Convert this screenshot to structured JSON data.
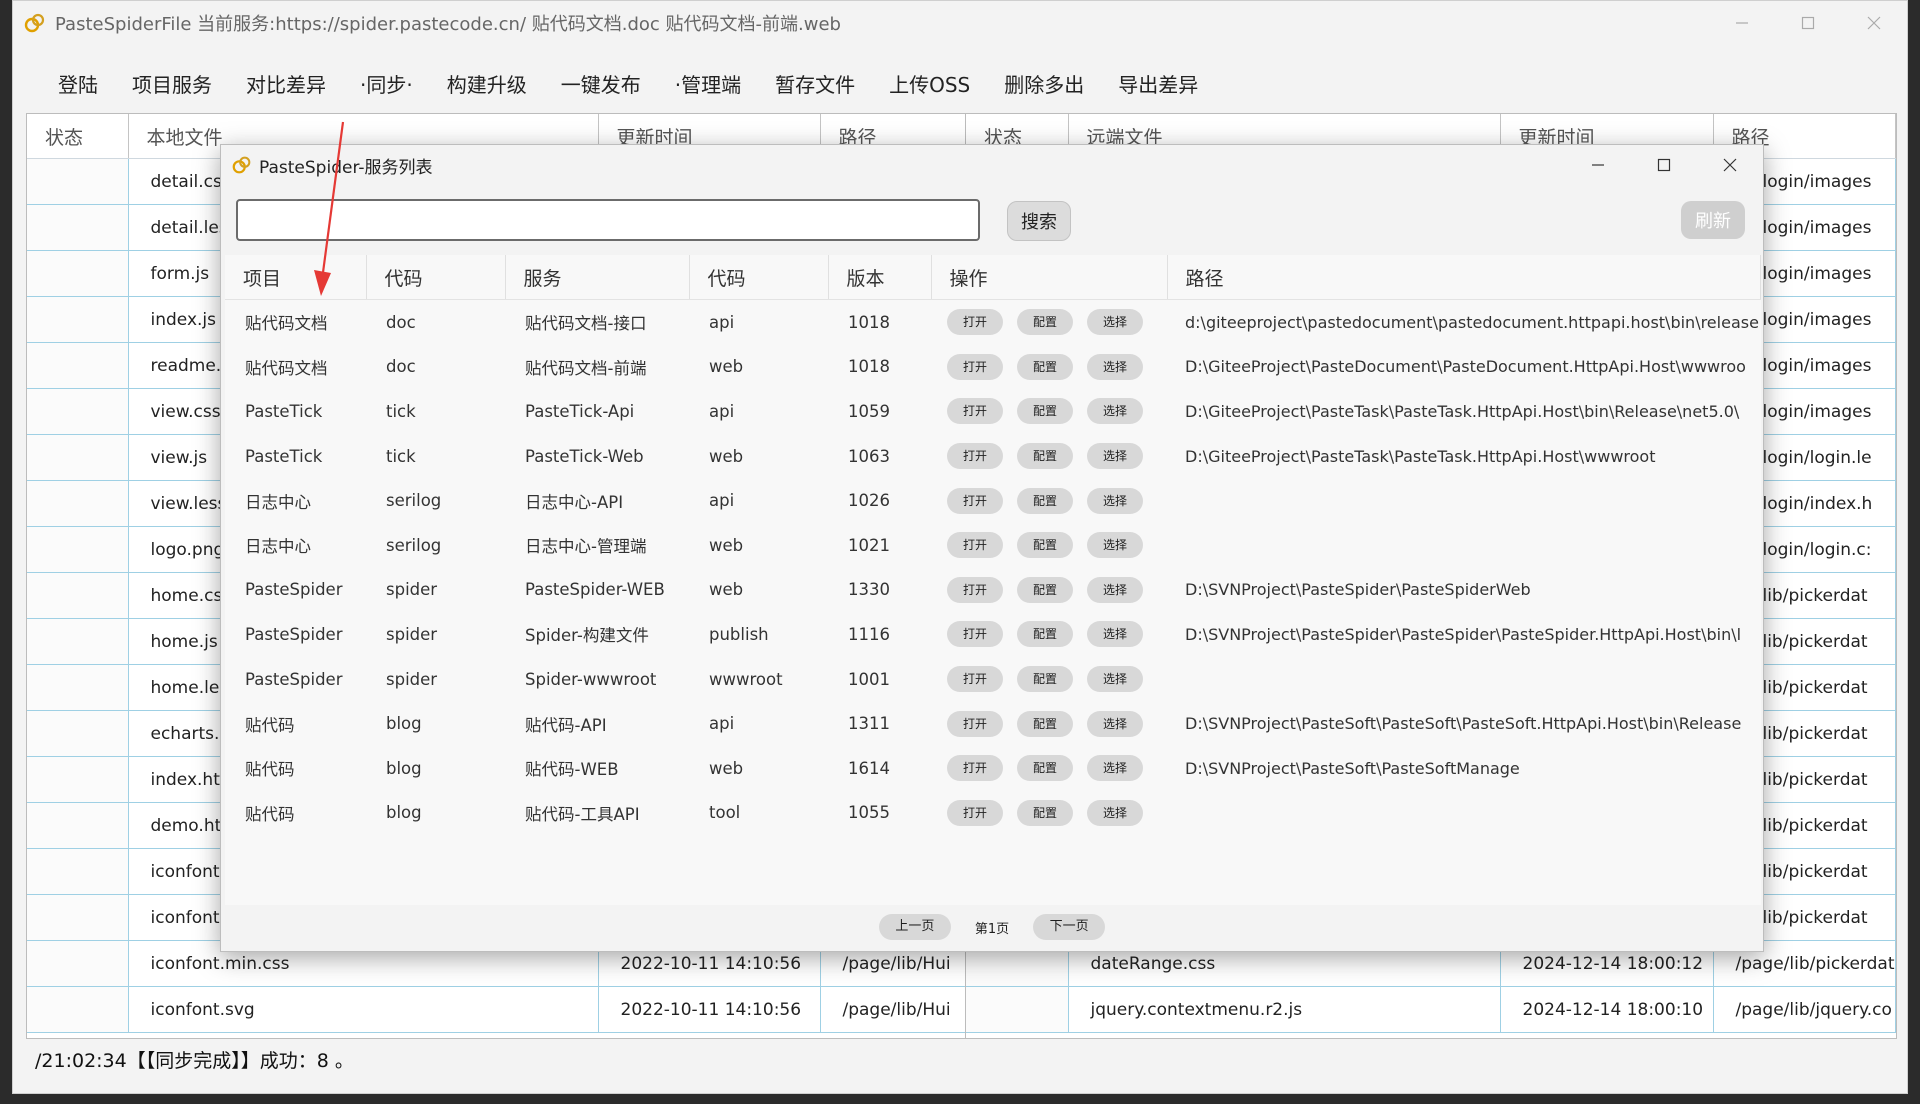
{
  "window": {
    "title": "PasteSpiderFile 当前服务:https://spider.pastecode.cn/ 贴代码文档.doc 贴代码文档-前端.web"
  },
  "menu": [
    "登陆",
    "项目服务",
    "对比差异",
    "·同步·",
    "构建升级",
    "一键发布",
    "·管理端",
    "暂存文件",
    "上传OSS",
    "删除多出",
    "导出差异"
  ],
  "left_table": {
    "headers": [
      "状态",
      "本地文件",
      "更新时间",
      "路径"
    ],
    "rows": [
      [
        "",
        "detail.css",
        "",
        ""
      ],
      [
        "",
        "detail.less",
        "",
        ""
      ],
      [
        "",
        "form.js",
        "",
        ""
      ],
      [
        "",
        "index.js",
        "",
        ""
      ],
      [
        "",
        "readme.md",
        "",
        ""
      ],
      [
        "",
        "view.css",
        "",
        ""
      ],
      [
        "",
        "view.js",
        "",
        ""
      ],
      [
        "",
        "view.less",
        "",
        ""
      ],
      [
        "",
        "logo.png",
        "",
        ""
      ],
      [
        "",
        "home.css",
        "",
        ""
      ],
      [
        "",
        "home.js",
        "",
        ""
      ],
      [
        "",
        "home.less",
        "",
        ""
      ],
      [
        "",
        "echarts.min.js",
        "",
        ""
      ],
      [
        "",
        "index.html",
        "",
        ""
      ],
      [
        "",
        "demo.html",
        "",
        ""
      ],
      [
        "",
        "iconfont.css",
        "",
        ""
      ],
      [
        "",
        "iconfont.eot",
        "",
        ""
      ],
      [
        "",
        "iconfont.min.css",
        "2022-10-11 14:10:56",
        "/page/lib/Hui"
      ],
      [
        "",
        "iconfont.svg",
        "2022-10-11 14:10:56",
        "/page/lib/Hui"
      ]
    ]
  },
  "right_table": {
    "headers": [
      "状态",
      "远端文件",
      "更新时间",
      "路径"
    ],
    "rows": [
      [
        "",
        "",
        "",
        "ge/login/images"
      ],
      [
        "",
        "",
        "",
        "ge/login/images"
      ],
      [
        "",
        "",
        "",
        "ge/login/images"
      ],
      [
        "",
        "",
        "",
        "ge/login/images"
      ],
      [
        "",
        "",
        "",
        "ge/login/images"
      ],
      [
        "",
        "",
        "",
        "ge/login/images"
      ],
      [
        "",
        "",
        "",
        "ge/login/login.le"
      ],
      [
        "",
        "",
        "",
        "ge/login/index.h"
      ],
      [
        "",
        "",
        "",
        "ge/login/login.c:"
      ],
      [
        "",
        "",
        "",
        "ge/lib/pickerdat"
      ],
      [
        "",
        "",
        "",
        "ge/lib/pickerdat"
      ],
      [
        "",
        "",
        "",
        "ge/lib/pickerdat"
      ],
      [
        "",
        "",
        "",
        "ge/lib/pickerdat"
      ],
      [
        "",
        "",
        "",
        "ge/lib/pickerdat"
      ],
      [
        "",
        "",
        "",
        "ge/lib/pickerdat"
      ],
      [
        "",
        "",
        "",
        "ge/lib/pickerdat"
      ],
      [
        "",
        "",
        "",
        "ge/lib/pickerdat"
      ],
      [
        "",
        "dateRange.css",
        "2024-12-14 18:00:12",
        "/page/lib/pickerdat"
      ],
      [
        "",
        "jquery.contextmenu.r2.js",
        "2024-12-14 18:00:10",
        "/page/lib/jquery.co"
      ]
    ]
  },
  "status": "/21:02:34【【同步完成】】成功：8 。",
  "dialog": {
    "title": "PasteSpider-服务列表",
    "search_placeholder": "",
    "search_value": "",
    "search_label": "搜索",
    "refresh_label": "刷新",
    "headers": [
      "项目",
      "代码",
      "服务",
      "代码",
      "版本",
      "操作",
      "路径"
    ],
    "ops": [
      "打开",
      "配置",
      "选择"
    ],
    "rows": [
      {
        "project": "贴代码文档",
        "pcode": "doc",
        "service": "贴代码文档-接口",
        "scode": "api",
        "version": "1018",
        "path": "d:\\giteeproject\\pastedocument\\pastedocument.httpapi.host\\bin\\release"
      },
      {
        "project": "贴代码文档",
        "pcode": "doc",
        "service": "贴代码文档-前端",
        "scode": "web",
        "version": "1018",
        "path": "D:\\GiteeProject\\PasteDocument\\PasteDocument.HttpApi.Host\\wwwroo"
      },
      {
        "project": "PasteTick",
        "pcode": "tick",
        "service": "PasteTick-Api",
        "scode": "api",
        "version": "1059",
        "path": "D:\\GiteeProject\\PasteTask\\PasteTask.HttpApi.Host\\bin\\Release\\net5.0\\"
      },
      {
        "project": "PasteTick",
        "pcode": "tick",
        "service": "PasteTick-Web",
        "scode": "web",
        "version": "1063",
        "path": "D:\\GiteeProject\\PasteTask\\PasteTask.HttpApi.Host\\wwwroot"
      },
      {
        "project": "日志中心",
        "pcode": "serilog",
        "service": "日志中心-API",
        "scode": "api",
        "version": "1026",
        "path": ""
      },
      {
        "project": "日志中心",
        "pcode": "serilog",
        "service": "日志中心-管理端",
        "scode": "web",
        "version": "1021",
        "path": ""
      },
      {
        "project": "PasteSpider",
        "pcode": "spider",
        "service": "PasteSpider-WEB",
        "scode": "web",
        "version": "1330",
        "path": "D:\\SVNProject\\PasteSpider\\PasteSpiderWeb"
      },
      {
        "project": "PasteSpider",
        "pcode": "spider",
        "service": "Spider-构建文件",
        "scode": "publish",
        "version": "1116",
        "path": "D:\\SVNProject\\PasteSpider\\PasteSpider\\PasteSpider.HttpApi.Host\\bin\\l"
      },
      {
        "project": "PasteSpider",
        "pcode": "spider",
        "service": "Spider-wwwroot",
        "scode": "wwwroot",
        "version": "1001",
        "path": ""
      },
      {
        "project": "贴代码",
        "pcode": "blog",
        "service": "贴代码-API",
        "scode": "api",
        "version": "1311",
        "path": "D:\\SVNProject\\PasteSoft\\PasteSoft\\PasteSoft.HttpApi.Host\\bin\\Release"
      },
      {
        "project": "贴代码",
        "pcode": "blog",
        "service": "贴代码-WEB",
        "scode": "web",
        "version": "1614",
        "path": "D:\\SVNProject\\PasteSoft\\PasteSoftManage"
      },
      {
        "project": "贴代码",
        "pcode": "blog",
        "service": "贴代码-工具API",
        "scode": "tool",
        "version": "1055",
        "path": ""
      }
    ],
    "pager": {
      "prev": "上一页",
      "current": "第1页",
      "next": "下一页"
    }
  },
  "colors": {
    "annotation_arrow": "#e53935",
    "grid_line": "#9fd0e4",
    "pill": "#d8d8d8"
  }
}
